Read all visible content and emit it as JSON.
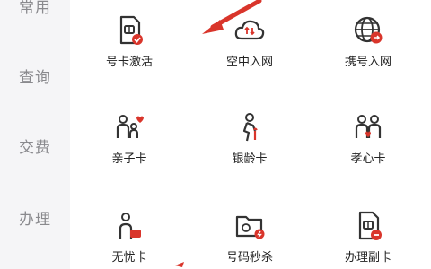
{
  "sidebar": {
    "items": [
      {
        "label": "常用"
      },
      {
        "label": "查询"
      },
      {
        "label": "交费"
      },
      {
        "label": "办理"
      }
    ]
  },
  "grid": {
    "tiles": [
      {
        "label": "号卡激活",
        "icon": "sim-card-check-icon"
      },
      {
        "label": "空中入网",
        "icon": "cloud-sync-icon"
      },
      {
        "label": "携号入网",
        "icon": "globe-transfer-icon"
      },
      {
        "label": "亲子卡",
        "icon": "parent-child-icon"
      },
      {
        "label": "银龄卡",
        "icon": "elderly-person-icon"
      },
      {
        "label": "孝心卡",
        "icon": "family-heart-icon"
      },
      {
        "label": "无忧卡",
        "icon": "person-card-icon"
      },
      {
        "label": "号码秒杀",
        "icon": "folder-flash-icon"
      },
      {
        "label": "办理副卡",
        "icon": "sim-card-secondary-icon"
      }
    ]
  },
  "colors": {
    "accent": "#d9352b",
    "icon_stroke": "#333333",
    "sidebar_bg": "#f5f5f7",
    "sidebar_text": "#8a8a8e"
  }
}
